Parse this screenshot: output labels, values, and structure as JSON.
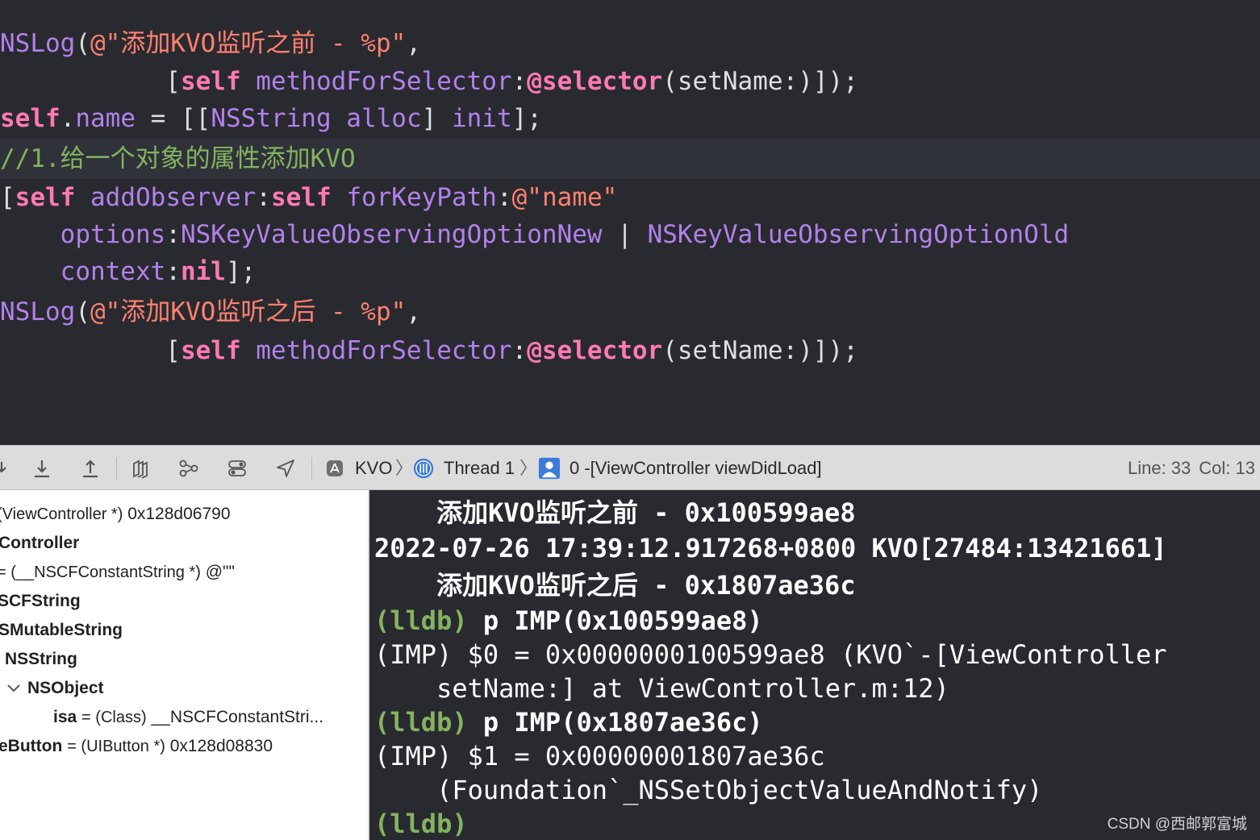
{
  "editor": {
    "lines": [
      [
        {
          "t": "NSLog",
          "c": "fn"
        },
        {
          "t": "(",
          "c": "pl"
        },
        {
          "t": "@\"添加KVO监听之前 - %p\"",
          "c": "str"
        },
        {
          "t": ",",
          "c": "pl"
        }
      ],
      [
        {
          "t": "           [",
          "c": "pl"
        },
        {
          "t": "self",
          "c": "kw"
        },
        {
          "t": " ",
          "c": "pl"
        },
        {
          "t": "methodForSelector",
          "c": "fn"
        },
        {
          "t": ":",
          "c": "pl"
        },
        {
          "t": "@selector",
          "c": "kw"
        },
        {
          "t": "(setName:)]);",
          "c": "pl"
        }
      ],
      [
        {
          "t": "self",
          "c": "kw"
        },
        {
          "t": ".",
          "c": "pl"
        },
        {
          "t": "name",
          "c": "fn"
        },
        {
          "t": " = [[",
          "c": "pl"
        },
        {
          "t": "NSString",
          "c": "fn"
        },
        {
          "t": " ",
          "c": "pl"
        },
        {
          "t": "alloc",
          "c": "fn"
        },
        {
          "t": "] ",
          "c": "pl"
        },
        {
          "t": "init",
          "c": "fn"
        },
        {
          "t": "];",
          "c": "pl"
        }
      ],
      [
        {
          "t": "//1.给一个对象的属性添加KVO",
          "c": "cmt"
        }
      ],
      [
        {
          "t": "[",
          "c": "pl"
        },
        {
          "t": "self",
          "c": "kw"
        },
        {
          "t": " ",
          "c": "pl"
        },
        {
          "t": "addObserver",
          "c": "fn"
        },
        {
          "t": ":",
          "c": "pl"
        },
        {
          "t": "self",
          "c": "kw"
        },
        {
          "t": " ",
          "c": "pl"
        },
        {
          "t": "forKeyPath",
          "c": "fn"
        },
        {
          "t": ":",
          "c": "pl"
        },
        {
          "t": "@\"name\"",
          "c": "str"
        }
      ],
      [
        {
          "t": "    ",
          "c": "pl"
        },
        {
          "t": "options",
          "c": "fn"
        },
        {
          "t": ":",
          "c": "pl"
        },
        {
          "t": "NSKeyValueObservingOptionNew",
          "c": "fn"
        },
        {
          "t": " | ",
          "c": "pl"
        },
        {
          "t": "NSKeyValueObservingOptionOld",
          "c": "fn"
        }
      ],
      [
        {
          "t": "    ",
          "c": "pl"
        },
        {
          "t": "context",
          "c": "fn"
        },
        {
          "t": ":",
          "c": "pl"
        },
        {
          "t": "nil",
          "c": "kw"
        },
        {
          "t": "];",
          "c": "pl"
        }
      ],
      [
        {
          "t": "NSLog",
          "c": "fn"
        },
        {
          "t": "(",
          "c": "pl"
        },
        {
          "t": "@\"添加KVO监听之后 - %p\"",
          "c": "str"
        },
        {
          "t": ",",
          "c": "pl"
        }
      ],
      [
        {
          "t": "           [",
          "c": "pl"
        },
        {
          "t": "self",
          "c": "kw"
        },
        {
          "t": " ",
          "c": "pl"
        },
        {
          "t": "methodForSelector",
          "c": "fn"
        },
        {
          "t": ":",
          "c": "pl"
        },
        {
          "t": "@selector",
          "c": "kw"
        },
        {
          "t": "(setName:)]);",
          "c": "pl"
        }
      ]
    ]
  },
  "toolbar": {
    "icons": [
      "step-into-icon",
      "step-out-icon",
      "view-hierarchy-icon",
      "memory-graph-icon",
      "environment-overrides-icon",
      "simulate-location-icon"
    ],
    "breadcrumb": {
      "target": "KVO",
      "thread": "Thread 1",
      "frame": "0 -[ViewController viewDidLoad]"
    },
    "line_label": "Line: 33",
    "col_label": "Col: 13"
  },
  "variables": [
    {
      "name": "",
      "type": "(ViewController *)",
      "value": "0x128d06790"
    },
    {
      "name": "Controller",
      "type": "",
      "value": ""
    },
    {
      "name": "",
      "type": "= (__NSCFConstantString *)",
      "value": "@\"\""
    },
    {
      "name": "SCFString",
      "type": "",
      "value": ""
    },
    {
      "name": "SMutableString",
      "type": "",
      "value": ""
    },
    {
      "name": "NSString",
      "type": "",
      "value": ""
    },
    {
      "name": "NSObject",
      "type": "",
      "value": ""
    },
    {
      "name": "isa",
      "type": "= (Class)",
      "value": "__NSCFConstantStri..."
    },
    {
      "name": "eButton",
      "type": "= (UIButton *)",
      "value": "0x128d08830"
    }
  ],
  "console": {
    "lines": [
      {
        "prompt": "",
        "text": "    添加KVO监听之前 - 0x100599ae8",
        "bold": true
      },
      {
        "prompt": "",
        "text": "2022-07-26 17:39:12.917268+0800 KVO[27484:13421661]",
        "bold": true
      },
      {
        "prompt": "",
        "text": "    添加KVO监听之后 - 0x1807ae36c",
        "bold": true
      },
      {
        "prompt": "(lldb)",
        "text": " p IMP(0x100599ae8)",
        "bold": true
      },
      {
        "prompt": "",
        "text": "(IMP) $0 = 0x0000000100599ae8 (KVO`-[ViewController",
        "bold": false
      },
      {
        "prompt": "",
        "text": "    setName:] at ViewController.m:12)",
        "bold": false
      },
      {
        "prompt": "(lldb)",
        "text": " p IMP(0x1807ae36c)",
        "bold": true
      },
      {
        "prompt": "",
        "text": "(IMP) $1 = 0x00000001807ae36c",
        "bold": false
      },
      {
        "prompt": "",
        "text": "    (Foundation`_NSSetObjectValueAndNotify)",
        "bold": false
      },
      {
        "prompt": "(lldb)",
        "text": "",
        "bold": true
      }
    ]
  },
  "watermark": "CSDN @西邮郭富城"
}
